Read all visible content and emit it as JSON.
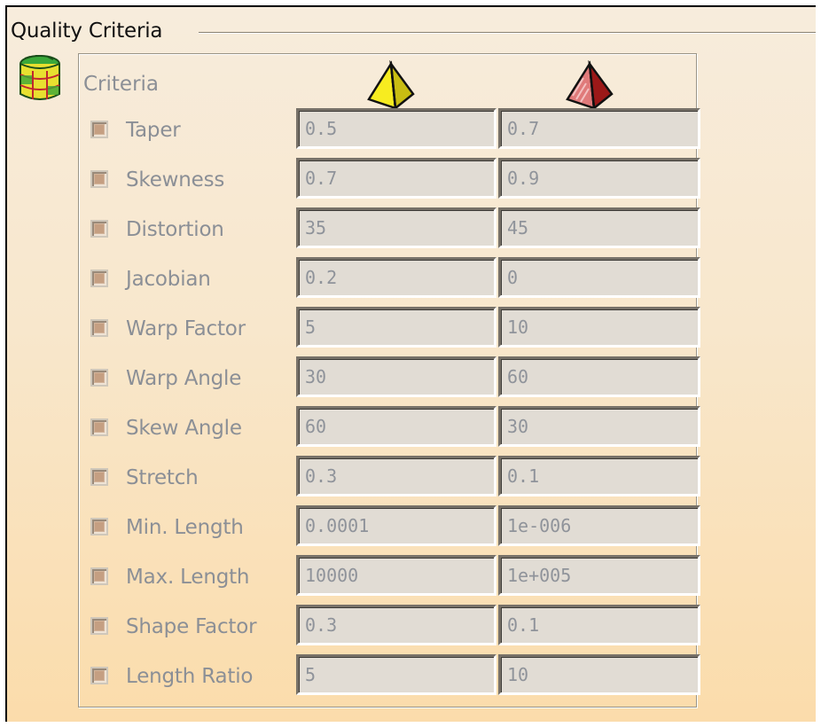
{
  "group": {
    "title": "Quality Criteria"
  },
  "header": {
    "label": "Criteria",
    "icons": [
      "grid-mesh-icon",
      "yellow-pyramid-icon",
      "red-pyramid-icon"
    ]
  },
  "colors": {
    "good_marker": "#f2e41a",
    "bad_marker": "#b02020",
    "label_text": "#8b8f96",
    "field_bg": "#e1dcd4"
  },
  "criteria": [
    {
      "label": "Taper",
      "good": "0.5",
      "bad": "0.7",
      "checked": false
    },
    {
      "label": "Skewness",
      "good": "0.7",
      "bad": "0.9",
      "checked": false
    },
    {
      "label": "Distortion",
      "good": "35",
      "bad": "45",
      "checked": false
    },
    {
      "label": "Jacobian",
      "good": "0.2",
      "bad": "0",
      "checked": false
    },
    {
      "label": "Warp Factor",
      "good": "5",
      "bad": "10",
      "checked": false
    },
    {
      "label": "Warp Angle",
      "good": "30",
      "bad": "60",
      "checked": false
    },
    {
      "label": "Skew Angle",
      "good": "60",
      "bad": "30",
      "checked": false
    },
    {
      "label": "Stretch",
      "good": "0.3",
      "bad": "0.1",
      "checked": false
    },
    {
      "label": "Min. Length",
      "good": "0.0001",
      "bad": "1e-006",
      "checked": false
    },
    {
      "label": "Max. Length",
      "good": "10000",
      "bad": "1e+005",
      "checked": false
    },
    {
      "label": "Shape Factor",
      "good": "0.3",
      "bad": "0.1",
      "checked": false
    },
    {
      "label": "Length Ratio",
      "good": "5",
      "bad": "10",
      "checked": false
    }
  ]
}
